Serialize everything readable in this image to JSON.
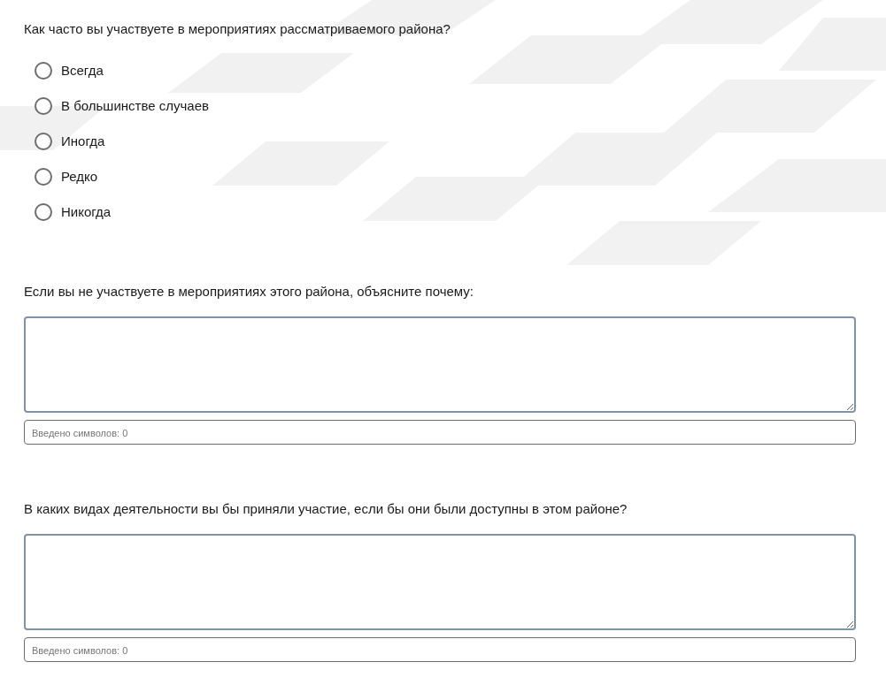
{
  "questions": [
    {
      "kind": "radio",
      "text": "Как часто вы участвуете в мероприятиях рассматриваемого района?",
      "options": [
        {
          "label": "Всегда",
          "selected": false
        },
        {
          "label": "В большинстве случаев",
          "selected": false
        },
        {
          "label": "Иногда",
          "selected": false
        },
        {
          "label": "Редко",
          "selected": false
        },
        {
          "label": "Никогда",
          "selected": false
        }
      ]
    },
    {
      "kind": "textarea",
      "text": "Если вы не участвуете в мероприятиях этого района, объясните почему:",
      "counter": "Введено символов: 0"
    },
    {
      "kind": "textarea",
      "text": "В каких видах деятельности вы бы приняли участие, если бы они были доступны в этом районе?",
      "counter": "Введено символов: 0"
    }
  ]
}
